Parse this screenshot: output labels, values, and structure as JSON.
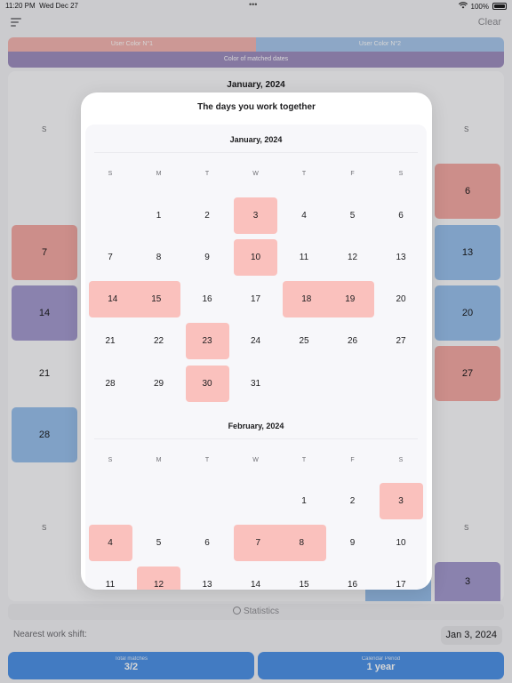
{
  "status_bar": {
    "time": "11:20 PM",
    "date": "Wed Dec 27",
    "battery": "100%"
  },
  "header": {
    "clear_label": "Clear"
  },
  "legend": {
    "user1": "User Color N°1",
    "user2": "User Color N°2",
    "matched": "Color of matched dates"
  },
  "background_calendar": {
    "month": "January, 2024",
    "left_col_days": [
      "7",
      "14",
      "21",
      "28"
    ],
    "right_col_days": [
      "6",
      "13",
      "20",
      "27"
    ],
    "bottom_right_day": "3",
    "dow_left": "S",
    "dow_right": "S",
    "bottom_dow_left": "S",
    "bottom_dow_right": "S"
  },
  "modal": {
    "title": "The days you work together",
    "weekdays": [
      "S",
      "M",
      "T",
      "W",
      "T",
      "F",
      "S"
    ],
    "months": [
      {
        "name": "January, 2024",
        "weeks": [
          [
            "",
            "1",
            "2",
            "3",
            "4",
            "5",
            "6"
          ],
          [
            "7",
            "8",
            "9",
            "10",
            "11",
            "12",
            "13"
          ],
          [
            "14",
            "15",
            "16",
            "17",
            "18",
            "19",
            "20"
          ],
          [
            "21",
            "22",
            "23",
            "24",
            "25",
            "26",
            "27"
          ],
          [
            "28",
            "29",
            "30",
            "31",
            "",
            "",
            ""
          ]
        ],
        "highlighted": [
          "3",
          "10",
          "14",
          "15",
          "18",
          "19",
          "23",
          "30"
        ]
      },
      {
        "name": "February, 2024",
        "weeks": [
          [
            "",
            "",
            "",
            "",
            "1",
            "2",
            "3"
          ],
          [
            "4",
            "5",
            "6",
            "7",
            "8",
            "9",
            "10"
          ],
          [
            "11",
            "12",
            "13",
            "14",
            "15",
            "16",
            "17"
          ]
        ],
        "highlighted": [
          "3",
          "4",
          "7",
          "8",
          "12"
        ]
      }
    ]
  },
  "statistics": {
    "label": "Statistics"
  },
  "nearest": {
    "label": "Nearest work shift:",
    "date": "Jan 3, 2024"
  },
  "buttons": {
    "left": {
      "caption": "Total matches",
      "value": "3/2"
    },
    "right": {
      "caption": "Calendar Period",
      "value": "1 year"
    }
  },
  "colors": {
    "user1": "#f4b6b2",
    "user2": "#a9c8ec",
    "matched": "#9f8fc0",
    "highlight": "#fac1bd",
    "accent": "#4f93e8"
  }
}
